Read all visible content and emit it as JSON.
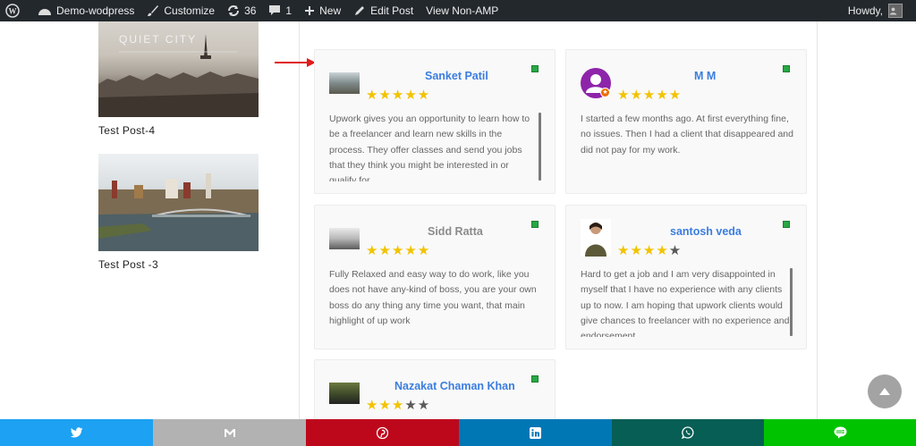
{
  "adminbar": {
    "site_name": "Demo-wodpress",
    "customize": "Customize",
    "updates_count": "36",
    "comments_count": "1",
    "new_label": "New",
    "edit_post": "Edit Post",
    "view_non_amp": "View Non-AMP",
    "howdy": "Howdy,"
  },
  "posts": [
    {
      "title": "Test Post-4",
      "thumb_watermark": "QUIET CITY"
    },
    {
      "title": "Test Post -3"
    }
  ],
  "reviews": [
    {
      "name": "Sanket Patil",
      "rating": 5,
      "text": "Upwork gives you an opportunity to learn how to be a freelancer and learn new skills in the process. They offer classes and send you jobs that they think you might be interested in or qualify for."
    },
    {
      "name": "M M",
      "rating": 5,
      "text": "I started a few months ago. At first everything fine, no issues. Then I had a client that disappeared and did not pay for my work."
    },
    {
      "name": "Sidd Ratta",
      "rating": 5,
      "text": "Fully Relaxed and easy way to do work, like you does not have any-kind of boss, you are your own boss do any thing any time you want, that main highlight of up work"
    },
    {
      "name": "santosh veda",
      "rating": 4,
      "text": "Hard to get a job and I am very disappointed in myself that I have no experience with any clients up to now. I am hoping that upwork clients would give chances to freelancer with no experience and endorsement."
    },
    {
      "name": "Nazakat Chaman Khan",
      "rating": 3,
      "text": ""
    }
  ],
  "share": {
    "twitter_color": "#1da1f2",
    "email_color": "#b2b2b2",
    "pinterest_color": "#bd081c",
    "linkedin_color": "#0077b5",
    "whatsapp_color": "#075e54",
    "line_color": "#00c300"
  },
  "icons": [
    "wordpress-icon",
    "brush-icon",
    "update-icon",
    "comment-icon",
    "plus-icon",
    "pencil-icon",
    "twitter-icon",
    "email-icon",
    "pinterest-icon",
    "linkedin-icon",
    "whatsapp-icon",
    "line-icon",
    "arrow-up-icon"
  ]
}
